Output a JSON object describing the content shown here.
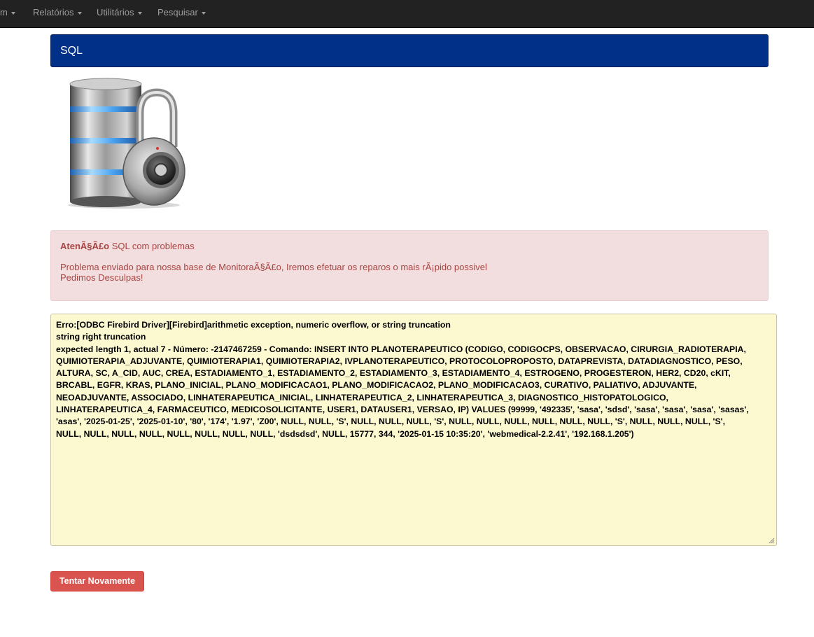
{
  "navbar": {
    "items": [
      {
        "label": "m"
      },
      {
        "label": "Relatórios"
      },
      {
        "label": "Utilitários"
      },
      {
        "label": "Pesquisar"
      }
    ]
  },
  "panel": {
    "title": "SQL"
  },
  "image": {
    "icon": "database-lock-icon"
  },
  "alert": {
    "heading_strong": "AtenÃ§Ã£o",
    "heading_rest": " SQL com problemas",
    "line1": "Problema enviado para nossa base de MonitoraÃ§Ã£o, Iremos efetuar os reparos o mais rÃ¡pido possivel",
    "line2": "Pedimos Desculpas!"
  },
  "error": {
    "text": "Erro:[ODBC Firebird Driver][Firebird]arithmetic exception, numeric overflow, or string truncation\nstring right truncation\nexpected length 1, actual 7 - Número: -2147467259 - Comando: INSERT INTO PLANOTERAPEUTICO (CODIGO, CODIGOCPS, OBSERVACAO, CIRURGIA_RADIOTERAPIA,\nQUIMIOTERAPIA_ADJUVANTE, QUIMIOTERAPIA1, QUIMIOTERAPIA2, IVPLANOTERAPEUTICO, PROTOCOLOPROPOSTO, DATAPREVISTA, DATADIAGNOSTICO, PESO,\nALTURA, SC, A_CID, AUC, CREA, ESTADIAMENTO_1, ESTADIAMENTO_2, ESTADIAMENTO_3, ESTADIAMENTO_4, ESTROGENO, PROGESTERON, HER2, CD20, cKIT,\nBRCABL, EGFR, KRAS, PLANO_INICIAL, PLANO_MODIFICACAO1, PLANO_MODIFICACAO2, PLANO_MODIFICACAO3, CURATIVO, PALIATIVO, ADJUVANTE,\nNEOADJUVANTE, ASSOCIADO, LINHATERAPEUTICA_INICIAL, LINHATERAPEUTICA_2, LINHATERAPEUTICA_3, DIAGNOSTICO_HISTOPATOLOGICO,\nLINHATERAPEUTICA_4, FARMACEUTICO, MEDICOSOLICITANTE, USER1, DATAUSER1, VERSAO, IP) VALUES (99999, '492335', 'sasa', 'sdsd', 'sasa', 'sasa', 'sasa', 'sasas',\n'asas', '2025-01-25', '2025-01-10', '80', '174', '1.97', 'Z00', NULL, NULL, 'S', NULL, NULL, NULL, 'S', NULL, NULL, NULL, NULL, NULL, NULL, 'S', NULL, NULL, NULL, 'S',\nNULL, NULL, NULL, NULL, NULL, NULL, NULL, NULL, 'dsdsdsd', NULL, 15777, 344, '2025-01-15 10:35:20', 'webmedical-2.2.41', '192.168.1.205')"
  },
  "actions": {
    "retry_label": "Tentar Novamente"
  },
  "colors": {
    "navbar_bg": "#222222",
    "panel_bg": "#003087",
    "alert_bg": "#f2dede",
    "alert_text": "#a94442",
    "error_bg": "#fcf8d0",
    "button_bg": "#d9534f"
  }
}
